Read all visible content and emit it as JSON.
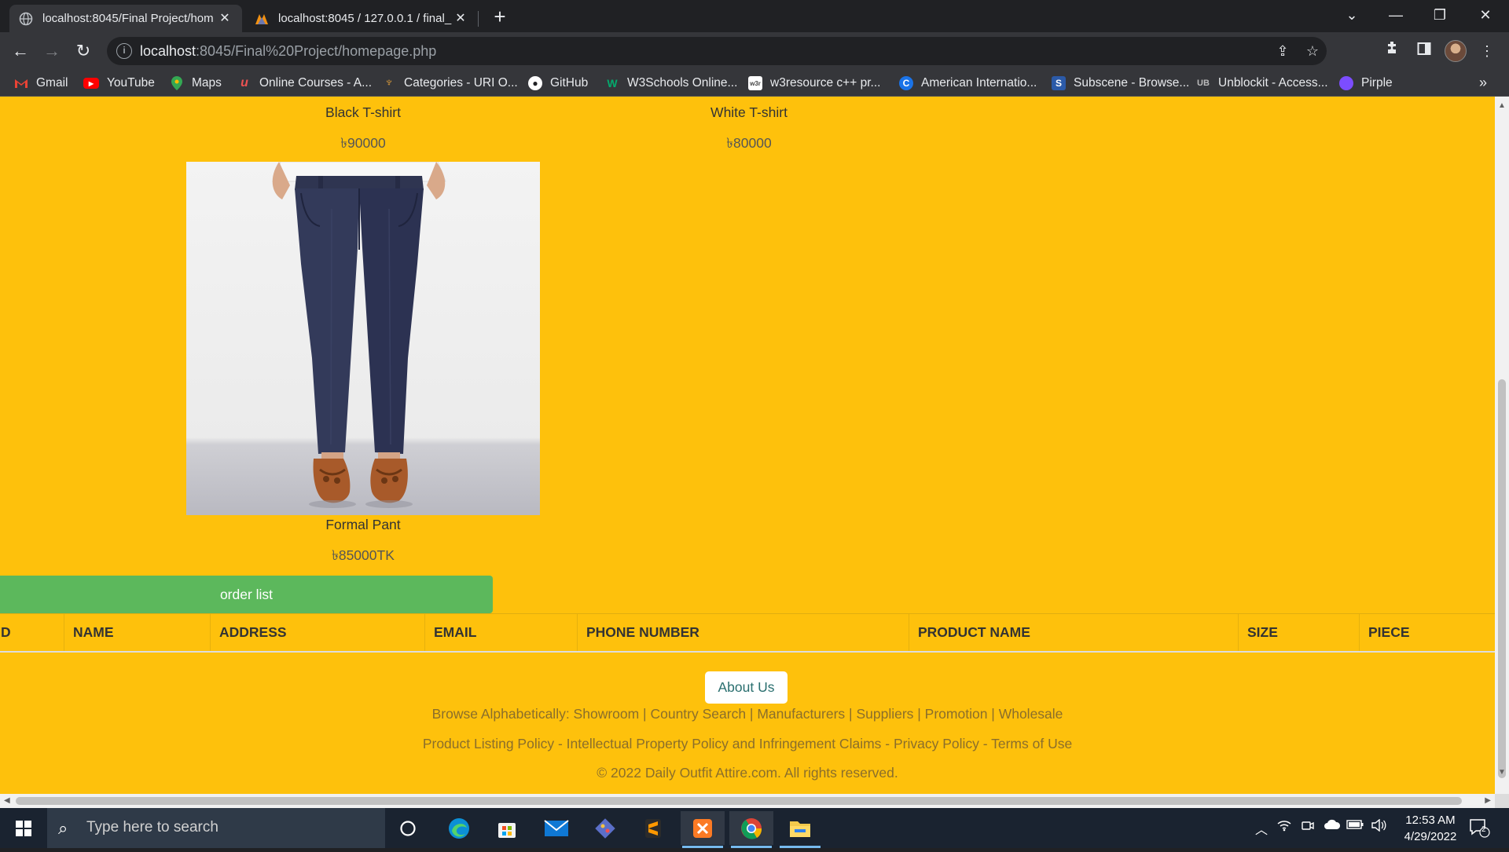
{
  "browser": {
    "tabs": [
      {
        "title": "localhost:8045/Final Project/hom",
        "active": true
      },
      {
        "title": "localhost:8045 / 127.0.0.1 / final_",
        "active": false
      }
    ],
    "url_host": "localhost",
    "url_rest": ":8045/Final%20Project/homepage.php",
    "bookmarks": [
      {
        "label": "Gmail",
        "icon": "gmail-icon"
      },
      {
        "label": "YouTube",
        "icon": "youtube-icon"
      },
      {
        "label": "Maps",
        "icon": "maps-icon"
      },
      {
        "label": "Online Courses - A...",
        "icon": "udemy-icon"
      },
      {
        "label": "Categories - URI O...",
        "icon": "uri-icon"
      },
      {
        "label": "GitHub",
        "icon": "github-icon"
      },
      {
        "label": "W3Schools Online...",
        "icon": "w3schools-icon"
      },
      {
        "label": "w3resource c++ pr...",
        "icon": "w3resource-icon"
      },
      {
        "label": "American Internatio...",
        "icon": "aiub-icon"
      },
      {
        "label": "Subscene - Browse...",
        "icon": "subscene-icon"
      },
      {
        "label": "Unblockit - Access...",
        "icon": "unblockit-icon"
      },
      {
        "label": "Pirple",
        "icon": "pirple-icon"
      }
    ]
  },
  "products": [
    {
      "name": "Black T-shirt",
      "price": "৳90000"
    },
    {
      "name": "White T-shirt",
      "price": "৳80000"
    },
    {
      "name": "Formal Pant",
      "price": "৳85000TK"
    }
  ],
  "order_button": "order list",
  "order_table": {
    "headers": [
      "D",
      "NAME",
      "ADDRESS",
      "EMAIL",
      "PHONE NUMBER",
      "PRODUCT NAME",
      "SIZE",
      "PIECE"
    ]
  },
  "footer": {
    "about_button": "About Us",
    "browse_line": "Browse Alphabetically: Showroom | Country Search | Manufacturers | Suppliers | Promotion | Wholesale",
    "policy_line": "Product Listing Policy - Intellectual Property Policy and Infringement Claims - Privacy Policy - Terms of Use",
    "copyright": "© 2022 Daily Outfit Attire.com. All rights reserved."
  },
  "taskbar": {
    "search_placeholder": "Type here to search",
    "time": "12:53 AM",
    "date": "4/29/2022",
    "notifications": "2"
  },
  "colors": {
    "page_background": "#fec10c",
    "order_button": "#5cb85c",
    "chrome_dark": "#202124"
  }
}
